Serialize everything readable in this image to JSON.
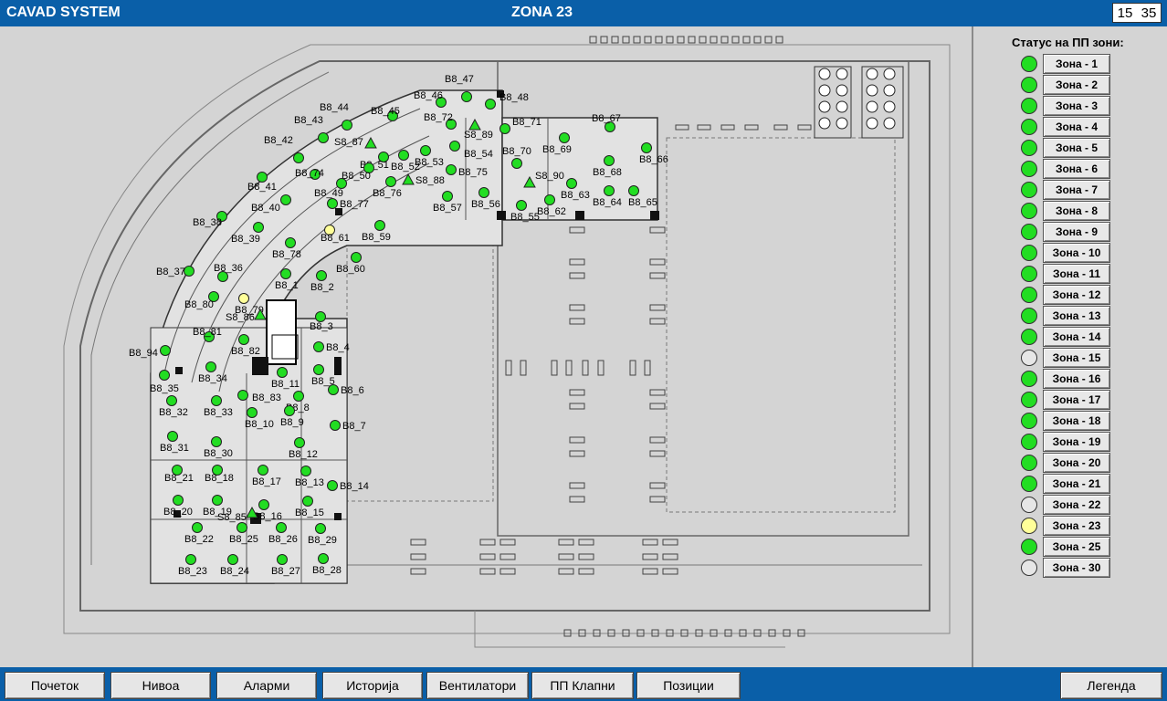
{
  "header": {
    "app_title": "CAVAD SYSTEM",
    "zone_title": "ZONA 23",
    "clock_hour": "15",
    "clock_minute": "35"
  },
  "sidebar": {
    "title": "Статус на ПП зони:",
    "zones": [
      {
        "label": "Зона - 1",
        "status": "green"
      },
      {
        "label": "Зона - 2",
        "status": "green"
      },
      {
        "label": "Зона - 3",
        "status": "green"
      },
      {
        "label": "Зона - 4",
        "status": "green"
      },
      {
        "label": "Зона - 5",
        "status": "green"
      },
      {
        "label": "Зона - 6",
        "status": "green"
      },
      {
        "label": "Зона - 7",
        "status": "green"
      },
      {
        "label": "Зона - 8",
        "status": "green"
      },
      {
        "label": "Зона - 9",
        "status": "green"
      },
      {
        "label": "Зона - 10",
        "status": "green"
      },
      {
        "label": "Зона - 11",
        "status": "green"
      },
      {
        "label": "Зона - 12",
        "status": "green"
      },
      {
        "label": "Зона - 13",
        "status": "green"
      },
      {
        "label": "Зона - 14",
        "status": "green"
      },
      {
        "label": "Зона - 15",
        "status": "grey"
      },
      {
        "label": "Зона - 16",
        "status": "green"
      },
      {
        "label": "Зона - 17",
        "status": "green"
      },
      {
        "label": "Зона - 18",
        "status": "green"
      },
      {
        "label": "Зона - 19",
        "status": "green"
      },
      {
        "label": "Зона - 20",
        "status": "green"
      },
      {
        "label": "Зона - 21",
        "status": "green"
      },
      {
        "label": "Зона - 22",
        "status": "grey"
      },
      {
        "label": "Зона - 23",
        "status": "yellow"
      },
      {
        "label": "Зона - 25",
        "status": "green"
      },
      {
        "label": "Зона - 30",
        "status": "grey"
      }
    ]
  },
  "status_colors": {
    "green": "#22dd22",
    "grey": "#e6e6e6",
    "yellow": "#ffff99"
  },
  "nav": {
    "buttons": [
      "Почеток",
      "Нивоа",
      "Аларми",
      "Историја",
      "Вентилатори",
      "ПП Клапни",
      "Позиции"
    ],
    "legend": "Легенда"
  },
  "floorplan": {
    "detectors": [
      {
        "label": "B8_47",
        "status": "green"
      },
      {
        "label": "B8_46",
        "status": "green"
      },
      {
        "label": "B8_48",
        "status": "green"
      },
      {
        "label": "B8_44",
        "status": "green"
      },
      {
        "label": "B8_45",
        "status": "green"
      },
      {
        "label": "B8_72",
        "status": "green"
      },
      {
        "label": "B8_43",
        "status": "green"
      },
      {
        "label": "B8_71",
        "status": "green"
      },
      {
        "label": "B8_67",
        "status": "green"
      },
      {
        "label": "B8_42",
        "status": "green"
      },
      {
        "label": "B8_51",
        "status": "green"
      },
      {
        "label": "B8_53",
        "status": "green"
      },
      {
        "label": "B8_54",
        "status": "green"
      },
      {
        "label": "B8_70",
        "status": "green"
      },
      {
        "label": "B8_69",
        "status": "green"
      },
      {
        "label": "B8_66",
        "status": "green"
      },
      {
        "label": "B8_74",
        "status": "green"
      },
      {
        "label": "B8_52",
        "status": "green"
      },
      {
        "label": "B8_75",
        "status": "green"
      },
      {
        "label": "B8_68",
        "status": "green"
      },
      {
        "label": "B8_41",
        "status": "green"
      },
      {
        "label": "B8_50",
        "status": "green"
      },
      {
        "label": "B8_49",
        "status": "green"
      },
      {
        "label": "B8_76",
        "status": "green"
      },
      {
        "label": "B8_63",
        "status": "green"
      },
      {
        "label": "B8_40",
        "status": "green"
      },
      {
        "label": "B8_77",
        "status": "green"
      },
      {
        "label": "B8_56",
        "status": "green"
      },
      {
        "label": "B8_57",
        "status": "green"
      },
      {
        "label": "B8_62",
        "status": "green"
      },
      {
        "label": "B8_64",
        "status": "green"
      },
      {
        "label": "B8_65",
        "status": "green"
      },
      {
        "label": "B8_55",
        "status": "green"
      },
      {
        "label": "B8_38",
        "status": "green"
      },
      {
        "label": "B8_39",
        "status": "green"
      },
      {
        "label": "B8_61",
        "status": "yellow"
      },
      {
        "label": "B8_59",
        "status": "green"
      },
      {
        "label": "B8_78",
        "status": "green"
      },
      {
        "label": "B8_60",
        "status": "green"
      },
      {
        "label": "B8_36",
        "status": "green"
      },
      {
        "label": "B8_37",
        "status": "green"
      },
      {
        "label": "B8_1",
        "status": "green"
      },
      {
        "label": "B8_2",
        "status": "green"
      },
      {
        "label": "B8_79",
        "status": "yellow"
      },
      {
        "label": "B8_80",
        "status": "green"
      },
      {
        "label": "B8_3",
        "status": "green"
      },
      {
        "label": "B8_81",
        "status": "green"
      },
      {
        "label": "B8_82",
        "status": "green"
      },
      {
        "label": "B8_4",
        "status": "green"
      },
      {
        "label": "B8_94",
        "status": "green"
      },
      {
        "label": "B8_5",
        "status": "green"
      },
      {
        "label": "B8_34",
        "status": "green"
      },
      {
        "label": "B8_35",
        "status": "green"
      },
      {
        "label": "B8_11",
        "status": "green"
      },
      {
        "label": "B8_6",
        "status": "green"
      },
      {
        "label": "B8_83",
        "status": "green"
      },
      {
        "label": "B8_8",
        "status": "green"
      },
      {
        "label": "B8_32",
        "status": "green"
      },
      {
        "label": "B8_33",
        "status": "green"
      },
      {
        "label": "B8_10",
        "status": "green"
      },
      {
        "label": "B8_9",
        "status": "green"
      },
      {
        "label": "B8_7",
        "status": "green"
      },
      {
        "label": "B8_31",
        "status": "green"
      },
      {
        "label": "B8_30",
        "status": "green"
      },
      {
        "label": "B8_12",
        "status": "green"
      },
      {
        "label": "B8_21",
        "status": "green"
      },
      {
        "label": "B8_18",
        "status": "green"
      },
      {
        "label": "B8_17",
        "status": "green"
      },
      {
        "label": "B8_13",
        "status": "green"
      },
      {
        "label": "B8_14",
        "status": "green"
      },
      {
        "label": "B8_20",
        "status": "green"
      },
      {
        "label": "B8_19",
        "status": "green"
      },
      {
        "label": "B8_16",
        "status": "green"
      },
      {
        "label": "B8_15",
        "status": "green"
      },
      {
        "label": "B8_22",
        "status": "green"
      },
      {
        "label": "B8_25",
        "status": "green"
      },
      {
        "label": "B8_26",
        "status": "green"
      },
      {
        "label": "B8_29",
        "status": "green"
      },
      {
        "label": "B8_23",
        "status": "green"
      },
      {
        "label": "B8_24",
        "status": "green"
      },
      {
        "label": "B8_27",
        "status": "green"
      },
      {
        "label": "B8_28",
        "status": "green"
      }
    ],
    "sensors": [
      {
        "label": "S8_87"
      },
      {
        "label": "S8_89"
      },
      {
        "label": "S8_88"
      },
      {
        "label": "S8_90"
      },
      {
        "label": "S8_86"
      },
      {
        "label": "S8_85"
      }
    ]
  }
}
